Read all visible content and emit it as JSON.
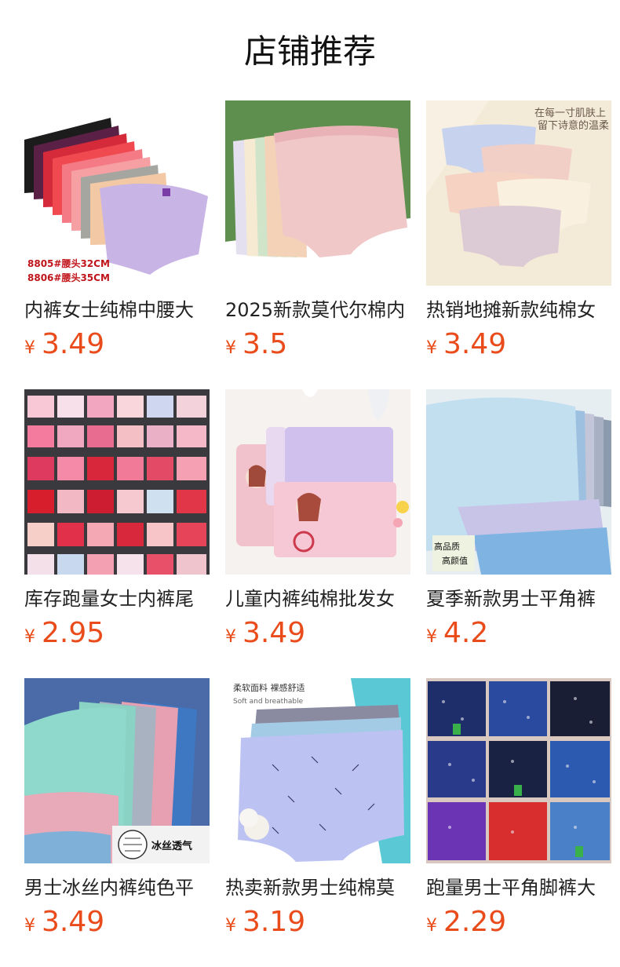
{
  "section_title": "店铺推荐",
  "products": [
    {
      "title": "内裤女士纯棉中腰大",
      "currency": "¥",
      "price": "3.49",
      "overlay": [
        "8805#腰头32CM",
        "8806#腰头35CM"
      ]
    },
    {
      "title": "2025新款莫代尔棉内",
      "currency": "¥",
      "price": "3.5",
      "overlay": []
    },
    {
      "title": "热销地摊新款纯棉女",
      "currency": "¥",
      "price": "3.49",
      "overlay": [
        "在每一寸肌肤上",
        "留下诗意的温柔"
      ]
    },
    {
      "title": "库存跑量女士内裤尾",
      "currency": "¥",
      "price": "2.95",
      "overlay": []
    },
    {
      "title": "儿童内裤纯棉批发女",
      "currency": "¥",
      "price": "3.49",
      "overlay": []
    },
    {
      "title": "夏季新款男士平角裤",
      "currency": "¥",
      "price": "4.2",
      "overlay": [
        "高品质",
        "高颜值"
      ]
    },
    {
      "title": "男士冰丝内裤纯色平",
      "currency": "¥",
      "price": "3.49",
      "overlay": [
        "冰丝透气"
      ]
    },
    {
      "title": "热卖新款男士纯棉莫",
      "currency": "¥",
      "price": "3.19",
      "overlay": [
        "柔软面料 裸感舒适",
        "Soft and breathable"
      ]
    },
    {
      "title": "跑量男士平角脚裤大",
      "currency": "¥",
      "price": "2.29",
      "overlay": []
    }
  ],
  "colors": {
    "price": "#ea4b1a",
    "title": "#222222",
    "heading": "#111111"
  }
}
